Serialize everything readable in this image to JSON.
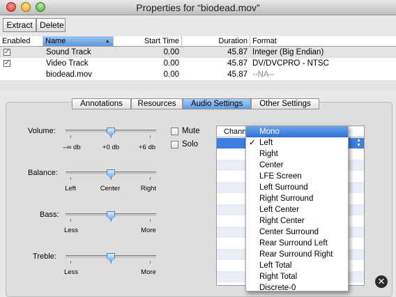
{
  "window": {
    "title": "Properties for “biodead.mov”"
  },
  "toolbar": {
    "extract": "Extract",
    "delete": "Delete"
  },
  "table": {
    "headers": {
      "enabled": "Enabled",
      "name": "Name",
      "start": "Start Time",
      "duration": "Duration",
      "format": "Format"
    },
    "rows": [
      {
        "checked": "✓",
        "name": "Sound Track",
        "start": "0.00",
        "duration": "45.87",
        "format": "Integer (Big Endian)"
      },
      {
        "checked": "✓",
        "name": "Video Track",
        "start": "0.00",
        "duration": "45.87",
        "format": "DV/DVCPRO - NTSC"
      },
      {
        "checked": "",
        "name": "biodead.mov",
        "start": "0.00",
        "duration": "45.87",
        "format": "--NA--"
      }
    ]
  },
  "tabs": [
    "Annotations",
    "Resources",
    "Audio Settings",
    "Other Settings"
  ],
  "controls": {
    "volume": {
      "label": "Volume:",
      "min": "–∞ db",
      "mid": "+0 db",
      "max": "+6 db",
      "level": 0.5
    },
    "balance": {
      "label": "Balance:",
      "min": "Left",
      "mid": "Center",
      "max": "Right",
      "level": 0.5
    },
    "bass": {
      "label": "Bass:",
      "min": "Less",
      "max": "More",
      "level": 0.5
    },
    "treble": {
      "label": "Treble:",
      "min": "Less",
      "max": "More",
      "level": 0.5
    }
  },
  "checks": {
    "mute": "Mute",
    "solo": "Solo"
  },
  "channel_header": "Chann",
  "menu": {
    "items": [
      "Mono",
      "Left",
      "Right",
      "Center",
      "LFE Screen",
      "Left Surround",
      "Right Surround",
      "Left Center",
      "Right Center",
      "Center Surround",
      "Rear Surround Left",
      "Rear Surround Right",
      "Left Total",
      "Right Total",
      "Discrete-0"
    ],
    "highlighted": "Mono",
    "checked": "Left",
    "checkmark": "✓"
  },
  "overlay": {
    "close": "✕"
  },
  "icons": {
    "sort": "sort-ascending-icon",
    "stepper": "up-down-arrows-icon"
  },
  "colors": {
    "selection": "#3d7fe0",
    "header_active": "#5b97de"
  }
}
